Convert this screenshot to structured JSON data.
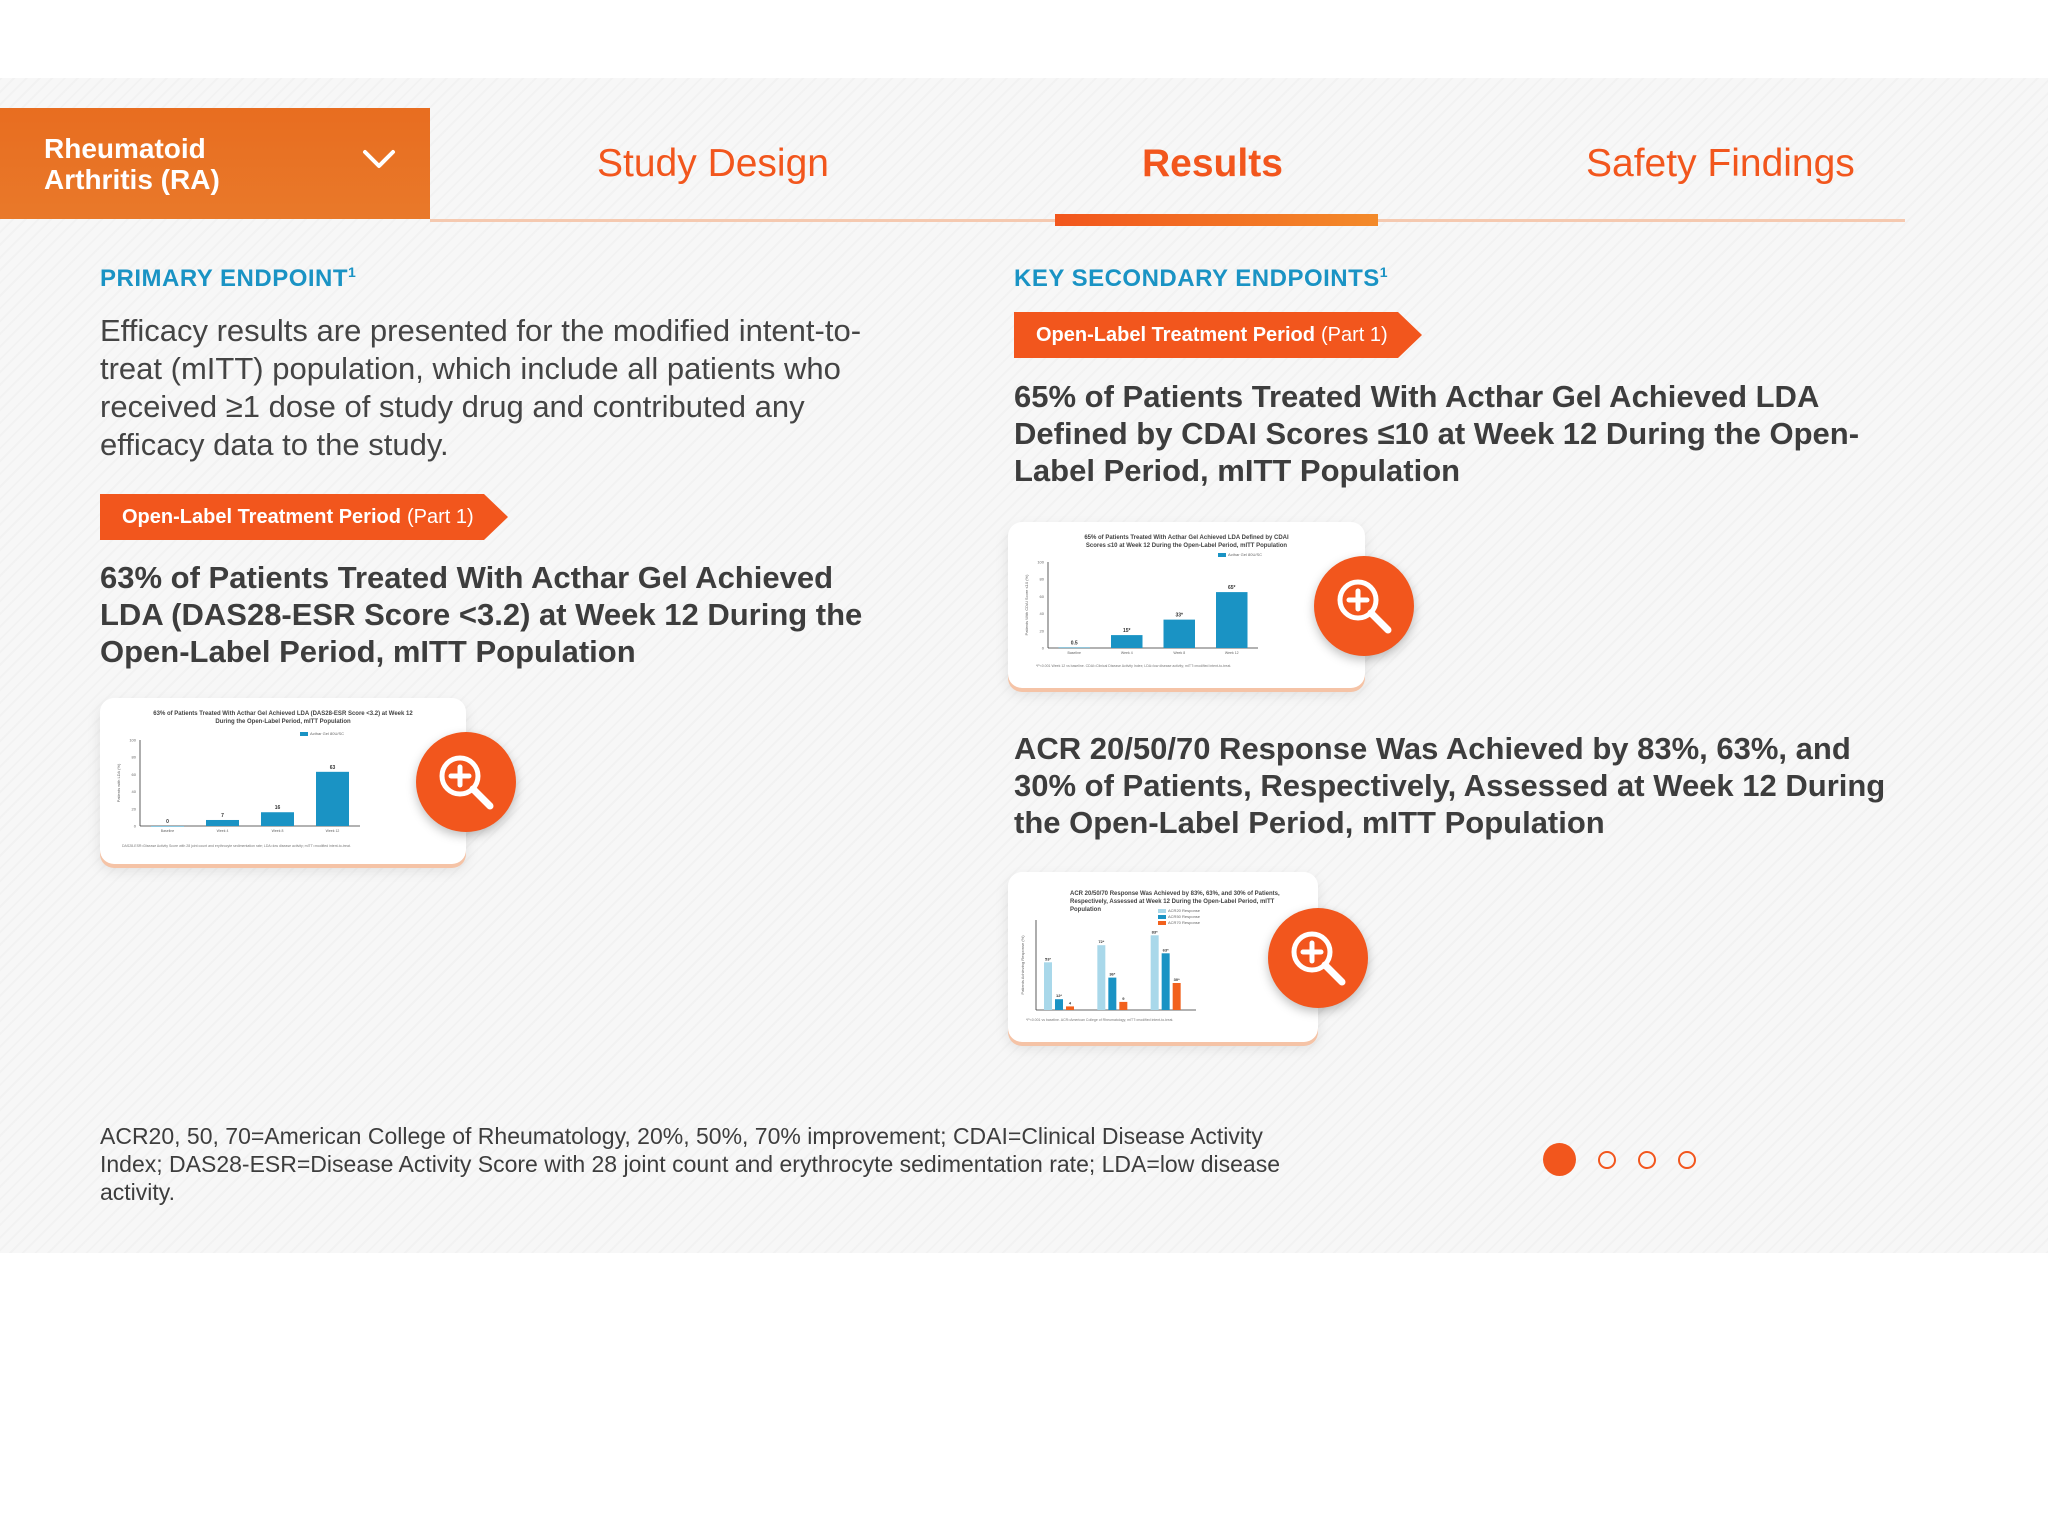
{
  "nav": {
    "dropdown_label": "Rheumatoid\nArthritis (RA)",
    "tabs": [
      {
        "label": "Study Design",
        "active": false
      },
      {
        "label": "Results",
        "active": true
      },
      {
        "label": "Safety Findings",
        "active": false
      }
    ],
    "accent_color": "#f2561d"
  },
  "left": {
    "section_label": "PRIMARY ENDPOINT",
    "section_sup": "1",
    "intro": "Efficacy results are presented for the modified intent-to-treat (mITT) population, which include all patients who received ≥1 dose of study drug and contributed any efficacy data to the study.",
    "ribbon_bold": "Open-Label Treatment Period",
    "ribbon_rest": "(Part 1)",
    "headline": "63% of Patients Treated With Acthar Gel Achieved LDA (DAS28-ESR Score <3.2) at Week 12 During the Open-Label Period, mITT Population",
    "thumb": {
      "title": "63% of Patients Treated With Acthar Gel Achieved LDA (DAS28-ESR Score <3.2) at Week 12 During the Open-Label Period, mITT Population",
      "legend": "Acthar Gel 80U/SC",
      "ylabel": "Patients with LDA (%)",
      "categories": [
        "Baseline",
        "Week 4",
        "Week 8",
        "Week 12"
      ],
      "values": [
        0,
        7,
        16,
        63
      ],
      "labels": [
        "0",
        "7",
        "16",
        "63"
      ],
      "yticks": [
        "100",
        "80",
        "60",
        "40",
        "20",
        "0"
      ],
      "footer": "DAS28-ESR=Disease Activity Score with 28 joint count and erythrocyte sedimentation rate; LDA=low disease activity; mITT=modified intent-to-treat."
    }
  },
  "right": {
    "section_label": "KEY SECONDARY ENDPOINTS",
    "section_sup": "1",
    "ribbon_bold": "Open-Label Treatment Period",
    "ribbon_rest": "(Part 1)",
    "headline1": "65% of Patients Treated With Acthar Gel Achieved LDA Defined by CDAI Scores ≤10 at Week 12 During the Open-Label Period, mITT Population",
    "thumb1": {
      "title": "65% of Patients Treated With Acthar Gel Achieved LDA Defined by CDAI Scores ≤10 at Week 12 During the Open-Label Period, mITT Population",
      "legend": "Acthar Gel 80U/SC",
      "ylabel": "Patients With CDAI Score ≤10 (%)",
      "categories": [
        "Baseline",
        "Week 4",
        "Week 8",
        "Week 12"
      ],
      "values": [
        0.5,
        15,
        33,
        65
      ],
      "labels": [
        "0.5",
        "15*",
        "33*",
        "65*"
      ],
      "yticks": [
        "100",
        "80",
        "60",
        "40",
        "20",
        "0"
      ],
      "footer": "*P<0.001 Week 12 vs baseline. CDAI=Clinical Disease Activity Index; LDA=low disease activity; mITT=modified intent-to-treat."
    },
    "headline2": "ACR 20/50/70 Response Was Achieved by 83%, 63%, and 30% of Patients, Respectively, Assessed at Week 12 During the Open-Label Period, mITT Population",
    "thumb2": {
      "title": "ACR 20/50/70 Response Was Achieved by 83%, 63%, and 30% of Patients, Respectively, Assessed at Week 12 During the Open-Label Period, mITT Population",
      "legend": [
        "ACR20 Response",
        "ACR50 Response",
        "ACR70 Response"
      ],
      "ylabel": "Patients Achieving Response (%)",
      "colors": [
        "#a9d8ea",
        "#1a93c4",
        "#f2611d"
      ],
      "groups": [
        {
          "values": [
            53,
            12,
            4
          ],
          "labels": [
            "53*",
            "12*",
            "4"
          ]
        },
        {
          "values": [
            72,
            36,
            9
          ],
          "labels": [
            "72*",
            "36*",
            "9"
          ]
        },
        {
          "values": [
            83,
            63,
            30
          ],
          "labels": [
            "83*",
            "63*",
            "30*"
          ]
        }
      ],
      "footer": "*P<0.001 vs baseline. ACR=American College of Rheumatology; mITT=modified intent-to-treat."
    }
  },
  "footnote": "ACR20, 50, 70=American College of Rheumatology, 20%, 50%, 70% improvement; CDAI=Clinical Disease Activity Index; DAS28-ESR=Disease Activity Score with 28 joint count and erythrocyte sedimentation rate; LDA=low disease activity.",
  "pagination": {
    "total": 4,
    "current": 1
  }
}
